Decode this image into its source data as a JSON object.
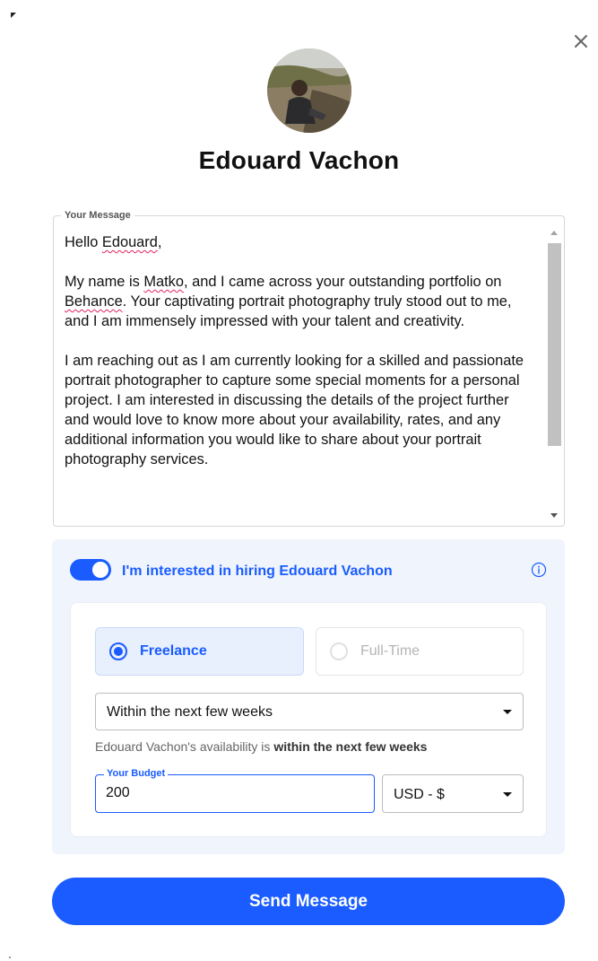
{
  "profile": {
    "name": "Edouard Vachon",
    "avatar": "avatar"
  },
  "close": {
    "icon": "close-icon"
  },
  "message": {
    "legend": "Your Message",
    "greeting_prefix": "Hello ",
    "greeting_name": "Edouard",
    "greeting_suffix": ",",
    "p1_a": "My name is ",
    "p1_name": "Matko",
    "p1_b": ", and I came across your outstanding portfolio on ",
    "p1_site": "Behance",
    "p1_c": ". Your captivating portrait photography truly stood out to me, and I am immensely impressed with your talent and creativity.",
    "p2": "I am reaching out as I am currently looking for a skilled and passionate portrait photographer to capture some special moments for a personal project. I am interested in discussing the details of the project further and would love to know more about your availability, rates, and any additional information you would like to share about your portrait photography services."
  },
  "hiring": {
    "toggle_on": true,
    "label": "I'm interested in hiring Edouard Vachon",
    "info_icon": "info-icon",
    "options": {
      "freelance": "Freelance",
      "fulltime": "Full-Time",
      "selected": "Freelance"
    },
    "availability": {
      "value": "Within the next few weeks",
      "note_prefix": "Edouard Vachon's availability is ",
      "note_value": "within the next few weeks"
    },
    "budget": {
      "legend": "Your Budget",
      "value": "200"
    },
    "currency": {
      "value": "USD - $"
    }
  },
  "send_button": {
    "label": "Send Message"
  },
  "colors": {
    "accent": "#1a5cff",
    "panel": "#f0f5fd"
  }
}
